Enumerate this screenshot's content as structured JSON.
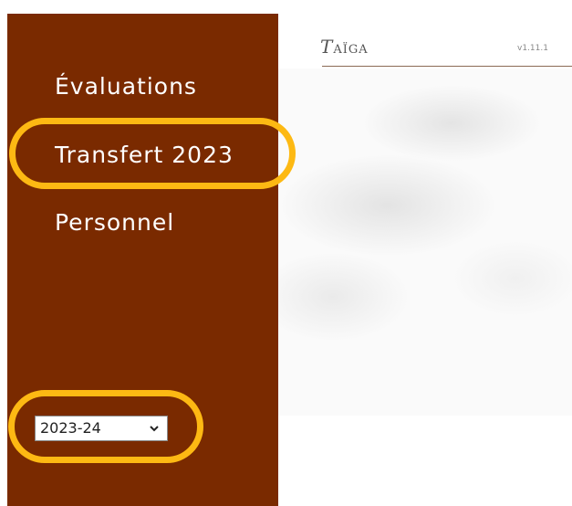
{
  "sidebar": {
    "items": [
      {
        "label": "Évaluations"
      },
      {
        "label": "Transfert 2023"
      },
      {
        "label": "Personnel"
      }
    ],
    "year_select": {
      "value": "2023-24"
    }
  },
  "header": {
    "logo_initial": "T",
    "logo_rest": "AÏGA",
    "version": "v1.11.1"
  },
  "colors": {
    "sidebar_bg": "#7a2a00",
    "highlight": "#fdb913"
  },
  "icons": {
    "select_arrow": "chevron-down-icon"
  }
}
